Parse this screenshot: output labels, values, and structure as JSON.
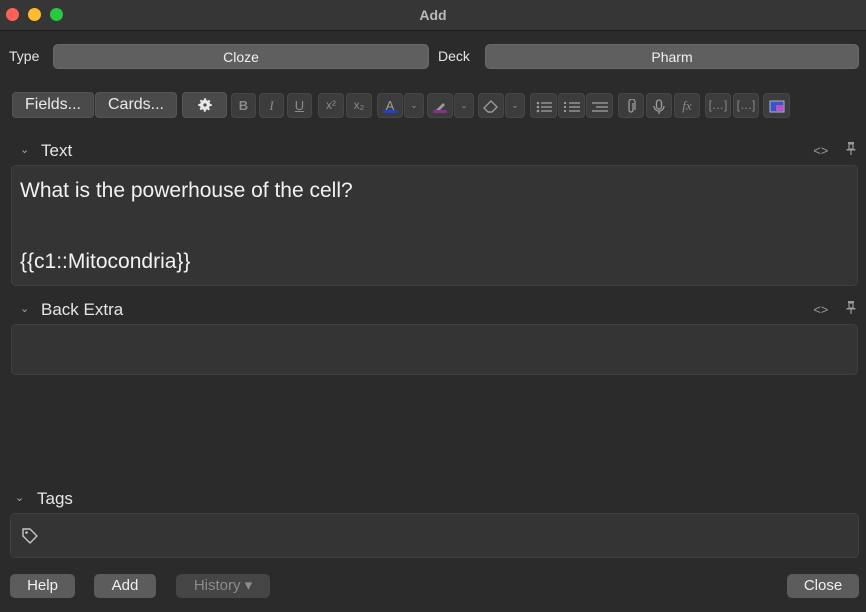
{
  "window": {
    "title": "Add"
  },
  "type_row": {
    "type_label": "Type",
    "type_value": "Cloze",
    "deck_label": "Deck",
    "deck_value": "Pharm"
  },
  "toolbar": {
    "fields_label": "Fields...",
    "cards_label": "Cards...",
    "icons": [
      "gear-icon",
      "bold-icon",
      "italic-icon",
      "underline-icon",
      "superscript-icon",
      "subscript-icon",
      "text-color-icon",
      "text-color-dropdown-icon",
      "highlight-icon",
      "highlight-dropdown-icon",
      "eraser-icon",
      "eraser-dropdown-icon",
      "bullet-list-icon",
      "numbered-list-icon",
      "align-icon",
      "attach-icon",
      "record-icon",
      "math-icon",
      "cloze-icon",
      "cloze-same-icon",
      "image-occlusion-icon"
    ],
    "bold": "B",
    "italic": "I",
    "underline": "U",
    "superscript": "x²",
    "subscript": "x₂",
    "text_color": "A",
    "math": "fx",
    "colors": {
      "text_color_bar": "#1f3fd8",
      "highlight_bar": "#8a2f8a"
    }
  },
  "fields": [
    {
      "name": "Text",
      "lines": [
        "What is the powerhouse of the cell?",
        "",
        "{{c1::Mitocondria}}"
      ]
    },
    {
      "name": "Back Extra",
      "lines": []
    }
  ],
  "field_icons": {
    "html": "<>",
    "pin": "⚲"
  },
  "tags": {
    "label": "Tags"
  },
  "buttons": {
    "help": "Help",
    "add": "Add",
    "history": "History ▾",
    "close": "Close"
  }
}
